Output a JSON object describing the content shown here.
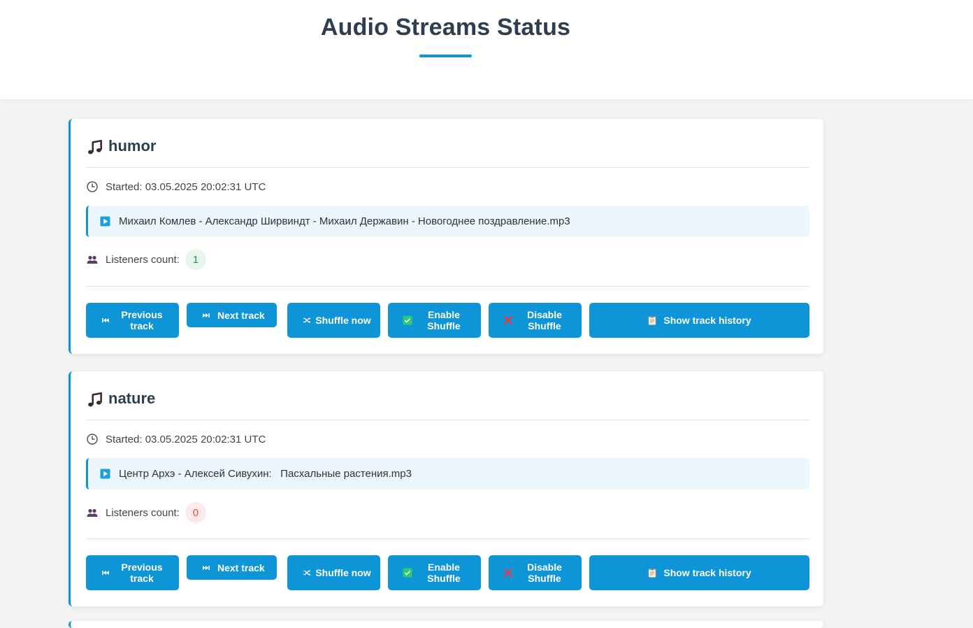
{
  "page": {
    "title": "Audio Streams Status"
  },
  "streams": [
    {
      "name": "humor",
      "started": "Started: 03.05.2025 20:02:31 UTC",
      "track": "Михаил Комлев - Александр Ширвиндт - Михаил Державин - Новогоднее поздравление.mp3",
      "listeners_label": "Listeners count:",
      "listeners": "1",
      "buttons": {
        "prev": "Previous track",
        "next": "Next track",
        "shuffle": "Shuffle now",
        "enable": "Enable Shuffle",
        "disable": "Disable Shuffle",
        "history": "Show track history"
      }
    },
    {
      "name": "nature",
      "started": "Started: 03.05.2025 20:02:31 UTC",
      "track": "Центр Архэ - Алексей Сивухин:   Пасхальные растения.mp3",
      "listeners_label": "Listeners count:",
      "listeners": "0",
      "buttons": {
        "prev": "Previous track",
        "next": "Next track",
        "shuffle": "Shuffle now",
        "enable": "Enable Shuffle",
        "disable": "Disable Shuffle",
        "history": "Show track history"
      }
    }
  ],
  "colors": {
    "accent": "#0d95d8",
    "title": "#2c3e50",
    "track_bg": "#ecf6fd",
    "badge_ok": "#e6f7ed",
    "badge_zero": "#fdeaea"
  },
  "icons": {
    "stream": "music-note-icon",
    "started": "clock-icon",
    "track": "play-icon",
    "listeners": "users-icon",
    "prev": "previous-icon",
    "next": "next-icon",
    "shuffle": "shuffle-icon",
    "enable": "check-icon",
    "disable": "cross-icon",
    "history": "clipboard-icon"
  }
}
